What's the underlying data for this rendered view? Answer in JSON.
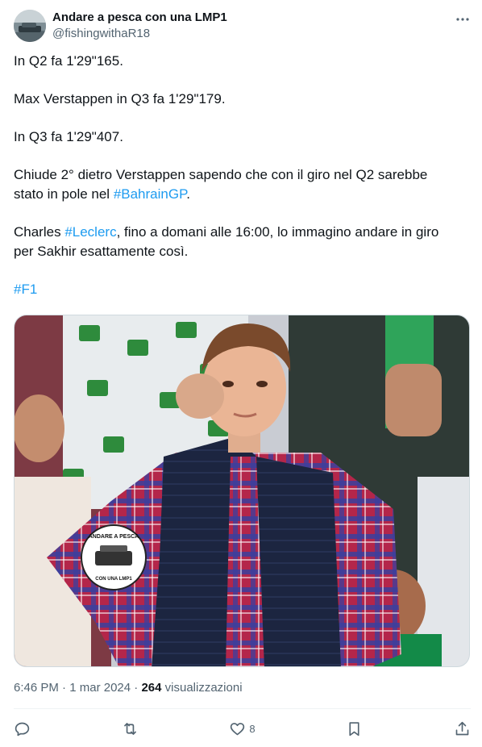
{
  "author": {
    "display_name": "Andare a pesca con una LMP1",
    "handle": "@fishingwithaR18"
  },
  "tweet": {
    "line1": "In Q2 fa 1'29\"165.",
    "line2": "Max Verstappen in Q3 fa 1'29\"179.",
    "line3": "In Q3 fa 1'29\"407.",
    "line4_pre": "Chiude 2° dietro Verstappen sapendo che con il giro nel Q2 sarebbe stato in pole nel ",
    "hashtag_bahrain": "#BahrainGP",
    "line4_post": ".",
    "line5_pre": "Charles ",
    "hashtag_leclerc": "#Leclerc",
    "line5_post": ", fino a domani alle 16:00, lo immagino andare in giro per Sakhir esattamente così.",
    "hashtag_f1": "#F1"
  },
  "media": {
    "watermark_top": "ANDARE A PESCA",
    "watermark_bottom": "CON UNA LMP1"
  },
  "meta": {
    "time": "6:46 PM",
    "separator": "·",
    "date": "1 mar 2024",
    "views_count": "264",
    "views_label": "visualizzazioni"
  },
  "actions": {
    "likes_count": "8"
  },
  "icons": {
    "more": "more-horizontal-icon",
    "reply": "reply-icon",
    "retweet": "retweet-icon",
    "like": "heart-icon",
    "bookmark": "bookmark-icon",
    "share": "share-icon"
  },
  "colors": {
    "link": "#1d9bf0",
    "secondary_text": "#536471",
    "primary_text": "#0f1419"
  }
}
